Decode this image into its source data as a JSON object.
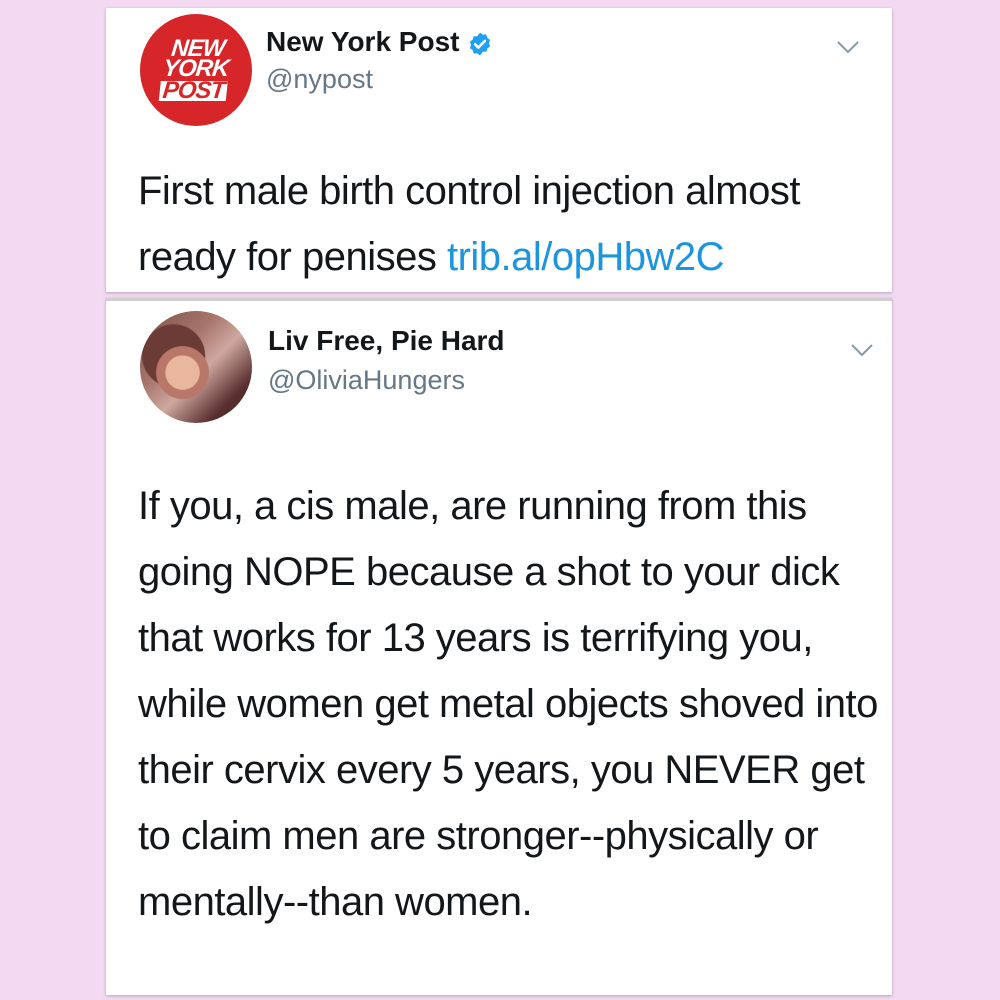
{
  "tweets": [
    {
      "display_name": "New York Post",
      "handle": "@nypost",
      "avatar_text": [
        "NEW",
        "YORK",
        "POST"
      ],
      "verified": true,
      "text": "First male birth control injection almost ready for penises ",
      "link": "trib.al/opHbw2C"
    },
    {
      "display_name": "Liv Free, Pie Hard",
      "handle": "@OliviaHungers",
      "verified": false,
      "text": "If you, a cis male, are running from this going NOPE because a shot to your dick that works for 13 years is terrifying you, while women get metal objects shoved into their cervix every 5 years, you NEVER get to claim men are stronger--physically or mentally--than women."
    }
  ],
  "colors": {
    "background": "#f3d9f2",
    "link": "#1b95e0",
    "verified": "#1da1f2",
    "nypost_red": "#d6262a",
    "handle": "#657786"
  },
  "icons": {
    "verified": "verified-badge-icon",
    "menu": "chevron-down-icon"
  }
}
